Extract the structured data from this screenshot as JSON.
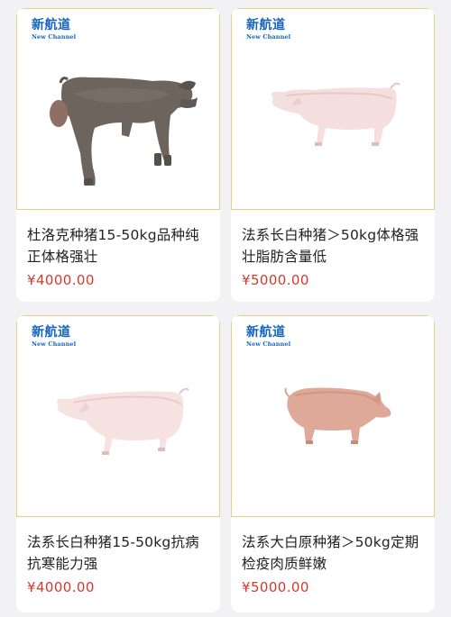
{
  "brand": {
    "cn": "新航道",
    "en": "New Channel"
  },
  "products": [
    {
      "image": "duroc-pig",
      "title": "杜洛克种猪15-50kg品种纯正体格强壮",
      "price": "¥4000.00"
    },
    {
      "image": "landrace-pig",
      "title": "法系长白种猪＞50kg体格强壮脂肪含量低",
      "price": "¥5000.00"
    },
    {
      "image": "landrace-pig",
      "title": "法系长白种猪15-50kg抗病抗寒能力强",
      "price": "¥4000.00"
    },
    {
      "image": "large-white-pig",
      "title": "法系大白原种猪＞50kg定期检疫肉质鲜嫩",
      "price": "¥5000.00"
    }
  ],
  "colors": {
    "price": "#d23a2e",
    "brand": "#1565c0",
    "image_border": "#e7cf86"
  }
}
